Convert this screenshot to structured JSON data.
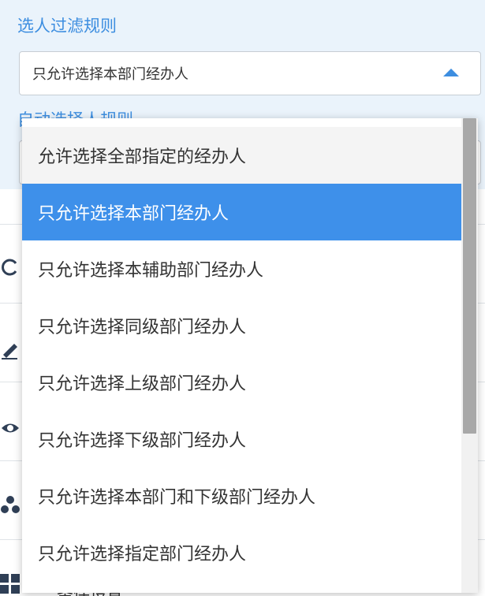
{
  "filter_rule": {
    "title": "选人过滤规则",
    "selected_value": "只允许选择本部门经办人"
  },
  "auto_select_rule": {
    "title": "自动选择人规则"
  },
  "dropdown": {
    "options": [
      "允许选择全部指定的经办人",
      "只允许选择本部门经办人",
      "只允许选择本辅助部门经办人",
      "只允许选择同级部门经办人",
      "只允许选择上级部门经办人",
      "只允许选择下级部门经办人",
      "只允许选择本部门和下级部门经办人",
      "只允许选择指定部门经办人"
    ],
    "selected_index": 1,
    "hovered_index": 0
  },
  "background_list": {
    "icons": [
      "refresh-icon",
      "edit-icon",
      "eye-icon",
      "fan-icon",
      "grid-icon"
    ],
    "last_item_label": "条件设置"
  },
  "colors": {
    "accent": "#3d8ee0",
    "selected_bg": "#3e90ea",
    "panel_bg": "#eaf3fb"
  }
}
